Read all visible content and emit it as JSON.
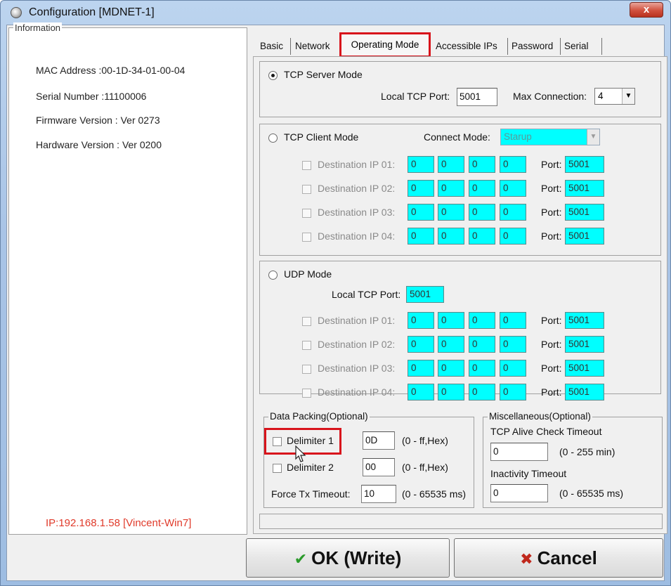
{
  "window": {
    "title": "Configuration [MDNET-1]",
    "close_glyph": "x"
  },
  "info": {
    "legend": "Information",
    "mac": "MAC Address :00-1D-34-01-00-04",
    "serial": "Serial Number :11100006",
    "firmware": "Firmware Version : Ver 0273",
    "hardware": "Hardware Version : Ver 0200",
    "ip": "IP:192.168.1.58 [Vincent-Win7]"
  },
  "tabs": [
    "Basic",
    "Network",
    "Operating Mode",
    "Accessible IPs",
    "Password",
    "Serial"
  ],
  "active_tab": "Operating Mode",
  "tcp_server": {
    "label": "TCP Server Mode",
    "selected": true,
    "local_port_label": "Local TCP Port:",
    "local_port": "5001",
    "max_conn_label": "Max Connection:",
    "max_conn": "4"
  },
  "tcp_client": {
    "label": "TCP Client  Mode",
    "connect_mode_label": "Connect Mode:",
    "connect_mode": "Starup",
    "rows": [
      {
        "label": "Destination IP 01:",
        "ip": [
          "0",
          "0",
          "0",
          "0"
        ],
        "port_label": "Port:",
        "port": "5001"
      },
      {
        "label": "Destination IP 02:",
        "ip": [
          "0",
          "0",
          "0",
          "0"
        ],
        "port_label": "Port:",
        "port": "5001"
      },
      {
        "label": "Destination IP 03:",
        "ip": [
          "0",
          "0",
          "0",
          "0"
        ],
        "port_label": "Port:",
        "port": "5001"
      },
      {
        "label": "Destination IP 04:",
        "ip": [
          "0",
          "0",
          "0",
          "0"
        ],
        "port_label": "Port:",
        "port": "5001"
      }
    ]
  },
  "udp": {
    "label": "UDP  Mode",
    "local_port_label": "Local TCP Port:",
    "local_port": "5001",
    "rows": [
      {
        "label": "Destination IP 01:",
        "ip": [
          "0",
          "0",
          "0",
          "0"
        ],
        "port_label": "Port:",
        "port": "5001"
      },
      {
        "label": "Destination IP 02:",
        "ip": [
          "0",
          "0",
          "0",
          "0"
        ],
        "port_label": "Port:",
        "port": "5001"
      },
      {
        "label": "Destination IP 03:",
        "ip": [
          "0",
          "0",
          "0",
          "0"
        ],
        "port_label": "Port:",
        "port": "5001"
      },
      {
        "label": "Destination IP 04:",
        "ip": [
          "0",
          "0",
          "0",
          "0"
        ],
        "port_label": "Port:",
        "port": "5001"
      }
    ]
  },
  "data_packing": {
    "legend": "Data Packing(Optional)",
    "delim1_label": "Delimiter 1",
    "delim1_value": "0D",
    "delim1_hint": "(0 - ff,Hex)",
    "delim2_label": "Delimiter 2",
    "delim2_value": "00",
    "delim2_hint": "(0 - ff,Hex)",
    "force_tx_label": "Force Tx Timeout:",
    "force_tx_value": "10",
    "force_tx_hint": "(0 - 65535 ms)"
  },
  "misc": {
    "legend": "Miscellaneous(Optional)",
    "alive_label": "TCP Alive Check Timeout",
    "alive_value": "0",
    "alive_hint": "(0 - 255 min)",
    "inactivity_label": "Inactivity Timeout",
    "inactivity_value": "0",
    "inactivity_hint": "(0 - 65535 ms)"
  },
  "buttons": {
    "ok": "OK (Write)",
    "cancel": "Cancel"
  },
  "colors": {
    "highlight": "#d8141c",
    "cyan_field": "#00ffff",
    "ip_text": "#e03a2a",
    "ok_icon": "#2a9a2a",
    "cancel_icon": "#c0281c"
  },
  "icons": {
    "ok": "check-icon",
    "cancel": "cross-icon"
  }
}
